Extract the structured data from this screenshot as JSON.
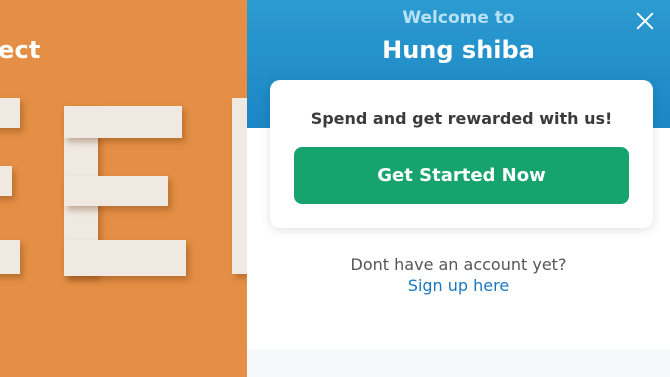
{
  "background": {
    "partial_text": "ect"
  },
  "widget": {
    "welcome": "Welcome to",
    "shop_name": "Hung shiba",
    "card": {
      "message": "Spend and get rewarded with us!",
      "cta_label": "Get Started Now"
    },
    "no_account_text": "Dont have an account yet?",
    "signup_label": "Sign up here",
    "close_icon": "close-icon"
  },
  "colors": {
    "header_blue": "#1a86c4",
    "cta_green": "#17a36e",
    "link_blue": "#1a78c2",
    "photo_orange": "#e48f45"
  }
}
